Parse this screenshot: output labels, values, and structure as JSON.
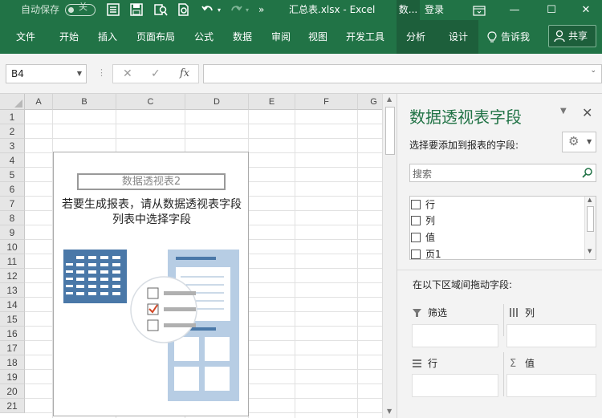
{
  "titlebar": {
    "autosave_label": "自动保存",
    "autosave_state": "关",
    "more_glyph": "»",
    "doc_title": "汇总表.xlsx  -  Excel",
    "context_tab": "数...",
    "login": "登录"
  },
  "ribbon": {
    "tabs": [
      "文件",
      "开始",
      "插入",
      "页面布局",
      "公式",
      "数据",
      "审阅",
      "视图",
      "开发工具"
    ],
    "context_tabs": [
      "分析",
      "设计"
    ],
    "tell_me": "告诉我",
    "share": "共享"
  },
  "formula_bar": {
    "name_box": "B4",
    "fx": "fx",
    "formula": ""
  },
  "grid": {
    "columns": [
      "A",
      "B",
      "C",
      "D",
      "E",
      "F",
      "G"
    ],
    "rows": [
      "1",
      "2",
      "3",
      "4",
      "5",
      "6",
      "7",
      "8",
      "9",
      "10",
      "11",
      "12",
      "13",
      "14",
      "15",
      "16",
      "17",
      "18",
      "19",
      "20",
      "21"
    ]
  },
  "pivot_placeholder": {
    "title": "数据透视表2",
    "hint": "若要生成报表，请从数据透视表字段列表中选择字段"
  },
  "field_pane": {
    "title": "数据透视表字段",
    "choose_label": "选择要添加到报表的字段:",
    "search_placeholder": "搜索",
    "fields": [
      "行",
      "列",
      "值",
      "页1"
    ],
    "drag_label": "在以下区域间拖动字段:",
    "areas": {
      "filter": "筛选",
      "columns": "列",
      "rows": "行",
      "values": "值"
    }
  },
  "colors": {
    "excel_green": "#217346",
    "context_green": "#1d5f3b",
    "illustration_blue": "#4a78a8",
    "check_red": "#d24726"
  }
}
